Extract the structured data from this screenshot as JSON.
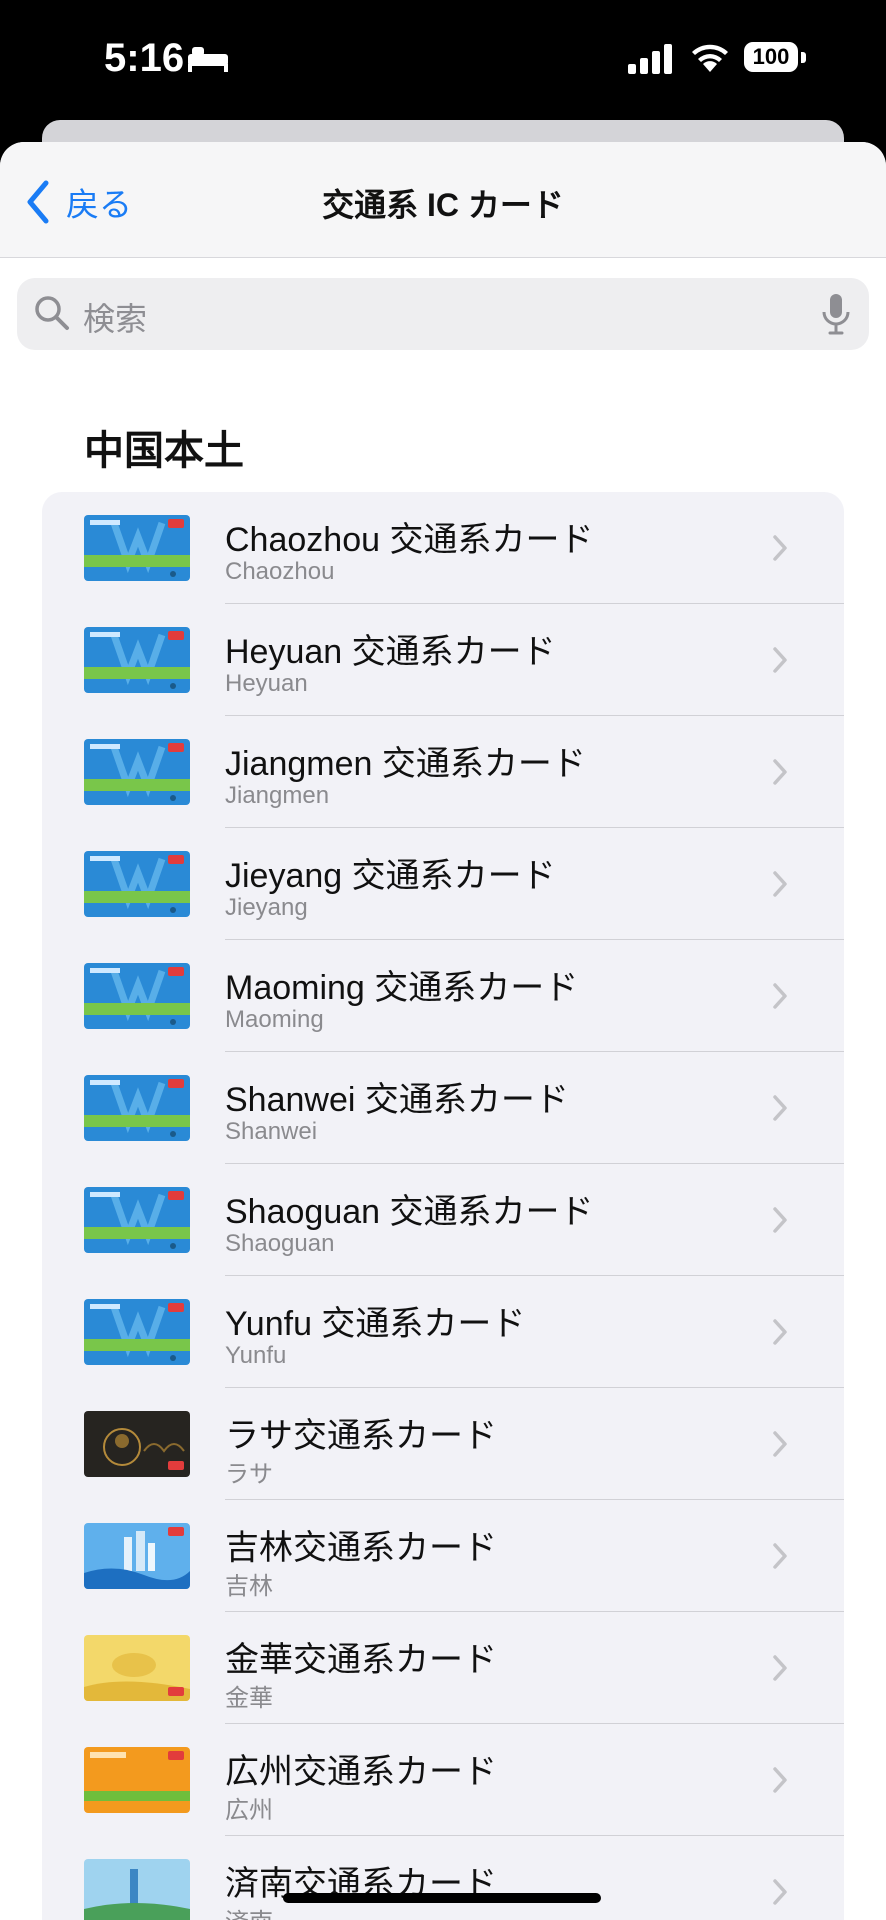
{
  "status_bar": {
    "time": "5:16",
    "battery": "100"
  },
  "nav": {
    "back_label": "戻る",
    "title": "交通系 IC カード"
  },
  "search": {
    "placeholder": "検索"
  },
  "section": {
    "title": "中国本土"
  },
  "colors": {
    "accent": "#1a7cf5",
    "row_bg": "#f2f2f7",
    "secondary_text": "#8a8a8e"
  },
  "cards": [
    {
      "title": "Chaozhou 交通系カード",
      "subtitle": "Chaozhou",
      "art": "blue"
    },
    {
      "title": "Heyuan 交通系カード",
      "subtitle": "Heyuan",
      "art": "blue"
    },
    {
      "title": "Jiangmen 交通系カード",
      "subtitle": "Jiangmen",
      "art": "blue"
    },
    {
      "title": "Jieyang 交通系カード",
      "subtitle": "Jieyang",
      "art": "blue"
    },
    {
      "title": "Maoming 交通系カード",
      "subtitle": "Maoming",
      "art": "blue"
    },
    {
      "title": "Shanwei 交通系カード",
      "subtitle": "Shanwei",
      "art": "blue"
    },
    {
      "title": "Shaoguan 交通系カード",
      "subtitle": "Shaoguan",
      "art": "blue"
    },
    {
      "title": "Yunfu 交通系カード",
      "subtitle": "Yunfu",
      "art": "blue"
    },
    {
      "title": "ラサ交通系カード",
      "subtitle": "ラサ",
      "art": "dark"
    },
    {
      "title": "吉林交通系カード",
      "subtitle": "吉林",
      "art": "city"
    },
    {
      "title": "金華交通系カード",
      "subtitle": "金華",
      "art": "gold"
    },
    {
      "title": "広州交通系カード",
      "subtitle": "広州",
      "art": "orange"
    },
    {
      "title": "済南交通系カード",
      "subtitle": "済南",
      "art": "sky"
    }
  ]
}
